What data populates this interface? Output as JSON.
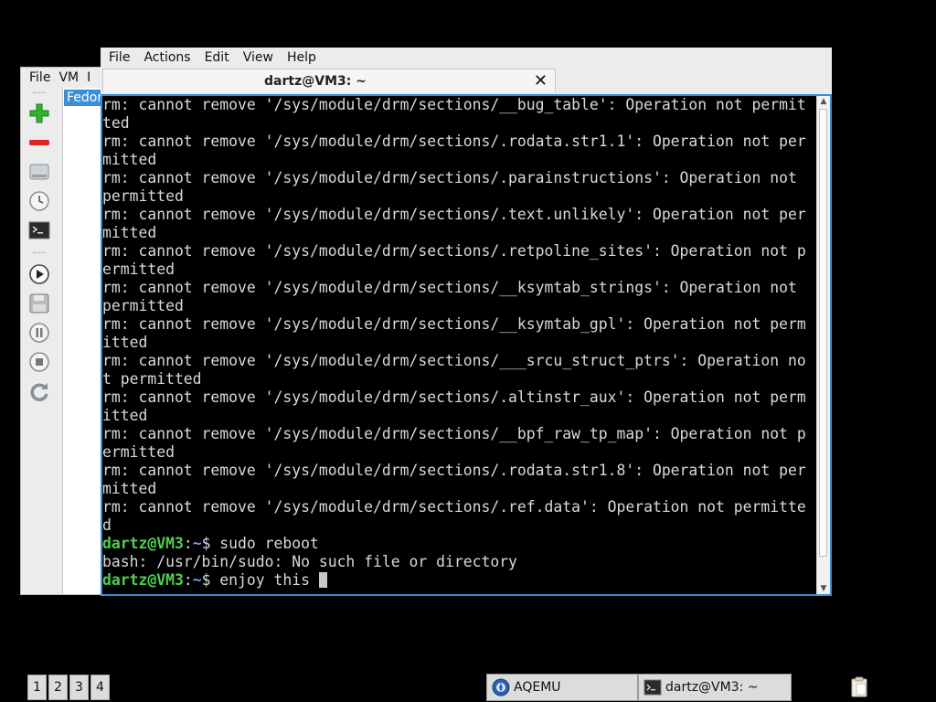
{
  "aqemu": {
    "menu": [
      "File",
      "VM",
      "I"
    ],
    "vm_item": "Fedor",
    "toolbar_icons": [
      "add-vm-icon",
      "remove-vm-icon",
      "drive-icon",
      "clock-icon",
      "console-icon",
      "play-icon",
      "save-icon",
      "pause-icon",
      "stop-icon",
      "reset-icon"
    ]
  },
  "terminal": {
    "menu": [
      "File",
      "Actions",
      "Edit",
      "View",
      "Help"
    ],
    "tab_title": "dartz@VM3: ~",
    "close_glyph": "✕",
    "lines": [
      {
        "text": "rm: cannot remove '/sys/module/drm/sections/__bug_table': Operation not permit"
      },
      {
        "text": "ted"
      },
      {
        "text": "rm: cannot remove '/sys/module/drm/sections/.rodata.str1.1': Operation not per"
      },
      {
        "text": "mitted"
      },
      {
        "text": "rm: cannot remove '/sys/module/drm/sections/.parainstructions': Operation not"
      },
      {
        "text": "permitted"
      },
      {
        "text": "rm: cannot remove '/sys/module/drm/sections/.text.unlikely': Operation not per"
      },
      {
        "text": "mitted"
      },
      {
        "text": "rm: cannot remove '/sys/module/drm/sections/.retpoline_sites': Operation not p"
      },
      {
        "text": "ermitted"
      },
      {
        "text": "rm: cannot remove '/sys/module/drm/sections/__ksymtab_strings': Operation not"
      },
      {
        "text": "permitted"
      },
      {
        "text": "rm: cannot remove '/sys/module/drm/sections/__ksymtab_gpl': Operation not perm"
      },
      {
        "text": "itted"
      },
      {
        "text": "rm: cannot remove '/sys/module/drm/sections/___srcu_struct_ptrs': Operation no"
      },
      {
        "text": "t permitted"
      },
      {
        "text": "rm: cannot remove '/sys/module/drm/sections/.altinstr_aux': Operation not perm"
      },
      {
        "text": "itted"
      },
      {
        "text": "rm: cannot remove '/sys/module/drm/sections/__bpf_raw_tp_map': Operation not p"
      },
      {
        "text": "ermitted"
      },
      {
        "text": "rm: cannot remove '/sys/module/drm/sections/.rodata.str1.8': Operation not per"
      },
      {
        "text": "mitted"
      },
      {
        "text": "rm: cannot remove '/sys/module/drm/sections/.ref.data': Operation not permitte"
      },
      {
        "text": "d"
      },
      {
        "user": "dartz@VM3",
        "colon": ":",
        "path": "~",
        "text": "$ sudo reboot"
      },
      {
        "text": "bash: /usr/bin/sudo: No such file or directory"
      },
      {
        "user": "dartz@VM3",
        "colon": ":",
        "path": "~",
        "text": "$ enjoy this "
      }
    ]
  },
  "taskbar": {
    "workspaces": [
      "1",
      "2",
      "3",
      "4"
    ],
    "tasks": [
      {
        "label": "AQEMU",
        "icon": "aqemu-icon"
      },
      {
        "label": "dartz@VM3: ~",
        "icon": "terminal-icon"
      }
    ],
    "tray_icon": "clipboard-icon"
  },
  "colors": {
    "accent": "#3c8bd6",
    "prompt_user": "#4ed04e",
    "prompt_path": "#6ea0ff",
    "terminal_bg": "#000000",
    "terminal_fg": "#d9d9d9"
  }
}
